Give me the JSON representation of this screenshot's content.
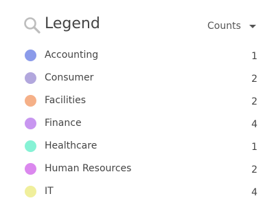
{
  "legend": {
    "title": "Legend",
    "search_icon": "search-icon",
    "sort": {
      "label": "Counts",
      "icon": "caret-down-icon"
    },
    "items": [
      {
        "label": "Accounting",
        "count": "1",
        "color": "#8b9bea"
      },
      {
        "label": "Consumer",
        "count": "2",
        "color": "#b2a7dd"
      },
      {
        "label": "Facilities",
        "count": "2",
        "color": "#f5b088"
      },
      {
        "label": "Finance",
        "count": "4",
        "color": "#c896f0"
      },
      {
        "label": "Healthcare",
        "count": "1",
        "color": "#86f2d5"
      },
      {
        "label": "Human Resources",
        "count": "2",
        "color": "#db88ee"
      },
      {
        "label": "IT",
        "count": "4",
        "color": "#f0ef9c"
      }
    ]
  }
}
